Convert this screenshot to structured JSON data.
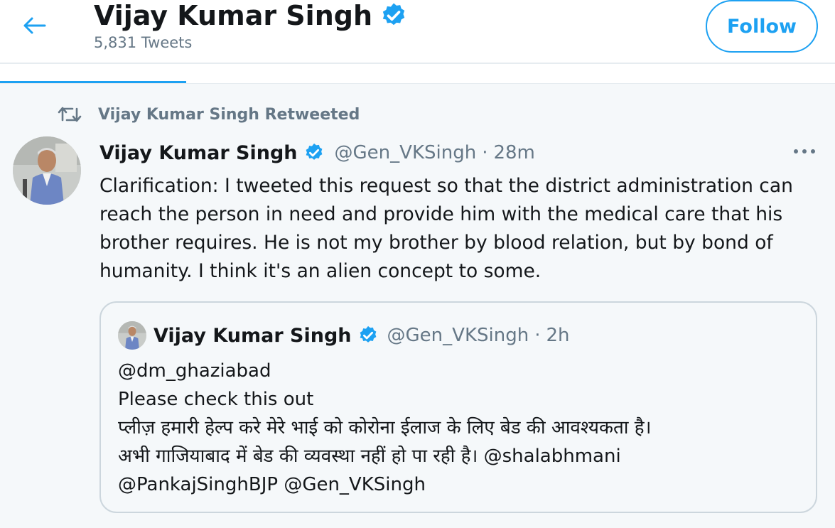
{
  "header": {
    "title": "Vijay Kumar Singh",
    "tweet_count": "5,831 Tweets",
    "follow_label": "Follow"
  },
  "tweet": {
    "retweet_label": "Vijay Kumar Singh Retweeted",
    "author_name": "Vijay Kumar Singh",
    "author_handle": "@Gen_VKSingh",
    "separator": "·",
    "time": "28m",
    "more_icon": "more-horizontal-icon",
    "body": "Clarification: I tweeted this request so that the district administration can reach the person in need and provide him with the medical care that his brother requires. He is not my brother by blood relation, but by bond of humanity. I think it's an alien concept to some."
  },
  "quote": {
    "author_name": "Vijay Kumar Singh",
    "author_handle": "@Gen_VKSingh",
    "separator": "·",
    "time": "2h",
    "lines": [
      "@dm_ghaziabad",
      "Please check this out",
      "प्लीज़ हमारी हेल्प करे मेरे भाई को कोरोना ईलाज के लिए बेड की आवश्यकता है।",
      "अभी गाजियाबाद में बेड की व्यवस्था नहीं हो पा रही है। @shalabhmani",
      "@PankajSinghBJP @Gen_VKSingh"
    ]
  },
  "colors": {
    "accent": "#1da1f2",
    "secondary_text": "#657786",
    "primary_text": "#14171a",
    "tweet_background": "#f5f8fa"
  },
  "icons": {
    "back": "arrow-left-icon",
    "verified": "verified-badge-icon",
    "retweet": "retweet-icon",
    "more": "more-horizontal-icon"
  }
}
